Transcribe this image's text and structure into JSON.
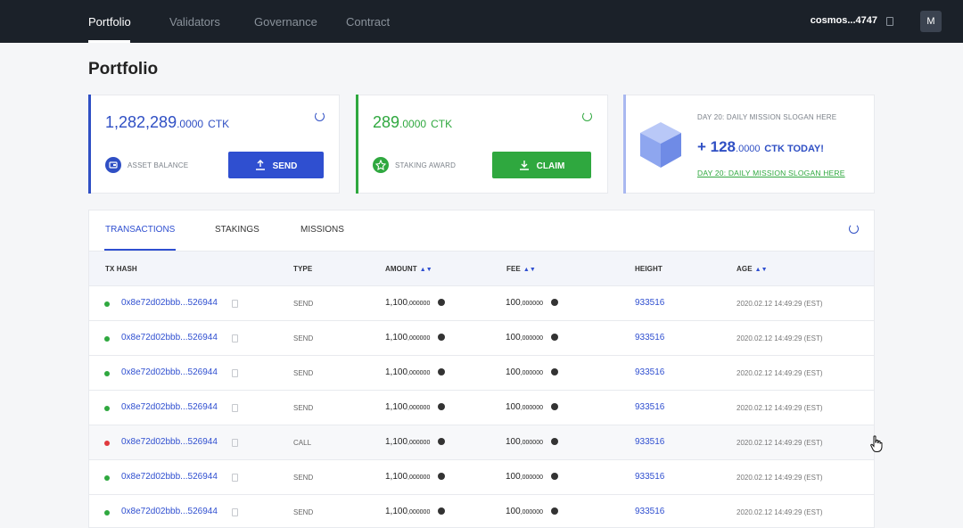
{
  "nav": {
    "items": [
      {
        "label": "Portfolio",
        "active": true
      },
      {
        "label": "Validators",
        "active": false
      },
      {
        "label": "Governance",
        "active": false
      },
      {
        "label": "Contract",
        "active": false
      }
    ],
    "address": "cosmos...4747",
    "avatar": "M"
  },
  "page_title": "Portfolio",
  "asset_card": {
    "amount_int": "1,282,289",
    "amount_dec": ".0000",
    "unit": "CTK",
    "label": "ASSET BALANCE",
    "button": "SEND",
    "accent": "#2f4fc4"
  },
  "staking_card": {
    "amount_int": "289",
    "amount_dec": ".0000",
    "unit": "CTK",
    "label": "STAKING AWARD",
    "button": "CLAIM",
    "accent": "#2fa83f"
  },
  "mission_card": {
    "title": "DAY 20: DAILY MISSION SLOGAN HERE",
    "amount_prefix": "+ 128",
    "amount_dec": ".0000",
    "amount_suffix": "CTK TODAY!",
    "link": "DAY 20: DAILY MISSION SLOGAN HERE",
    "accent": "#a9b8f0"
  },
  "tabs": [
    {
      "label": "TRANSACTIONS",
      "active": true
    },
    {
      "label": "STAKINGS",
      "active": false
    },
    {
      "label": "MISSIONS",
      "active": false
    }
  ],
  "columns": {
    "tx_hash": "TX HASH",
    "type": "TYPE",
    "amount": "AMOUNT",
    "fee": "FEE",
    "height": "HEIGHT",
    "age": "AGE"
  },
  "rows": [
    {
      "status": "#2fa83f",
      "hash": "0x8e72d02bbb...526944",
      "type": "SEND",
      "amount_int": "1,100",
      "amount_dec": ",000000",
      "fee_int": "100",
      "fee_dec": ",000000",
      "height": "933516",
      "age": "2020.02.12 14:49:29 (EST)"
    },
    {
      "status": "#2fa83f",
      "hash": "0x8e72d02bbb...526944",
      "type": "SEND",
      "amount_int": "1,100",
      "amount_dec": ",000000",
      "fee_int": "100",
      "fee_dec": ",000000",
      "height": "933516",
      "age": "2020.02.12 14:49:29 (EST)"
    },
    {
      "status": "#2fa83f",
      "hash": "0x8e72d02bbb...526944",
      "type": "SEND",
      "amount_int": "1,100",
      "amount_dec": ",000000",
      "fee_int": "100",
      "fee_dec": ",000000",
      "height": "933516",
      "age": "2020.02.12 14:49:29 (EST)"
    },
    {
      "status": "#2fa83f",
      "hash": "0x8e72d02bbb...526944",
      "type": "SEND",
      "amount_int": "1,100",
      "amount_dec": ",000000",
      "fee_int": "100",
      "fee_dec": ",000000",
      "height": "933516",
      "age": "2020.02.12 14:49:29 (EST)"
    },
    {
      "status": "#e0393e",
      "hash": "0x8e72d02bbb...526944",
      "type": "CALL",
      "amount_int": "1,100",
      "amount_dec": ",000000",
      "fee_int": "100",
      "fee_dec": ",000000",
      "height": "933516",
      "age": "2020.02.12 14:49:29 (EST)"
    },
    {
      "status": "#2fa83f",
      "hash": "0x8e72d02bbb...526944",
      "type": "SEND",
      "amount_int": "1,100",
      "amount_dec": ",000000",
      "fee_int": "100",
      "fee_dec": ",000000",
      "height": "933516",
      "age": "2020.02.12 14:49:29 (EST)"
    },
    {
      "status": "#2fa83f",
      "hash": "0x8e72d02bbb...526944",
      "type": "SEND",
      "amount_int": "1,100",
      "amount_dec": ",000000",
      "fee_int": "100",
      "fee_dec": ",000000",
      "height": "933516",
      "age": "2020.02.12 14:49:29 (EST)"
    }
  ]
}
